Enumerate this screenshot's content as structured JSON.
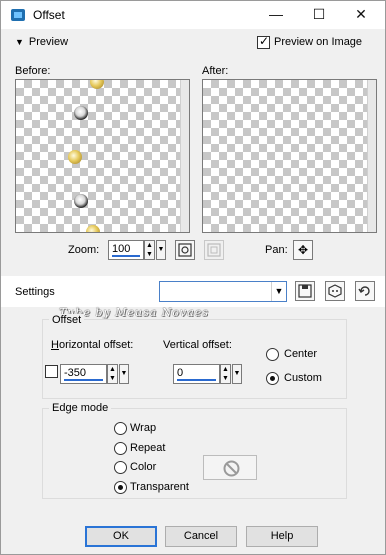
{
  "window": {
    "title": "Offset",
    "close_glyph": "✕",
    "minimize_glyph": "—",
    "maximize_glyph": "☐"
  },
  "preview": {
    "toggle_label": "Preview",
    "on_image_label": "Preview on Image",
    "on_image_checked": true
  },
  "before_label": "Before:",
  "after_label": "After:",
  "zoom": {
    "label": "Zoom:",
    "value": "100"
  },
  "pan_label": "Pan:",
  "settings": {
    "label": "Settings",
    "preset_value": ""
  },
  "watermark": "Tube by  Meusa Novaes",
  "offset": {
    "group_title": "Offset",
    "horizontal_label": "Horizontal offset:",
    "horizontal_value": "-350",
    "vertical_label": "Vertical offset:",
    "vertical_value": "0",
    "center_label": "Center",
    "custom_label": "Custom",
    "selected": "custom"
  },
  "edge_mode": {
    "group_title": "Edge mode",
    "options": [
      "Wrap",
      "Repeat",
      "Color",
      "Transparent"
    ],
    "selected": "Transparent"
  },
  "buttons": {
    "ok": "OK",
    "cancel": "Cancel",
    "help": "Help"
  },
  "colors": {
    "accent": "#2a74d6",
    "checker": "#c7c7c7",
    "window_bg": "#f0f0f0"
  }
}
